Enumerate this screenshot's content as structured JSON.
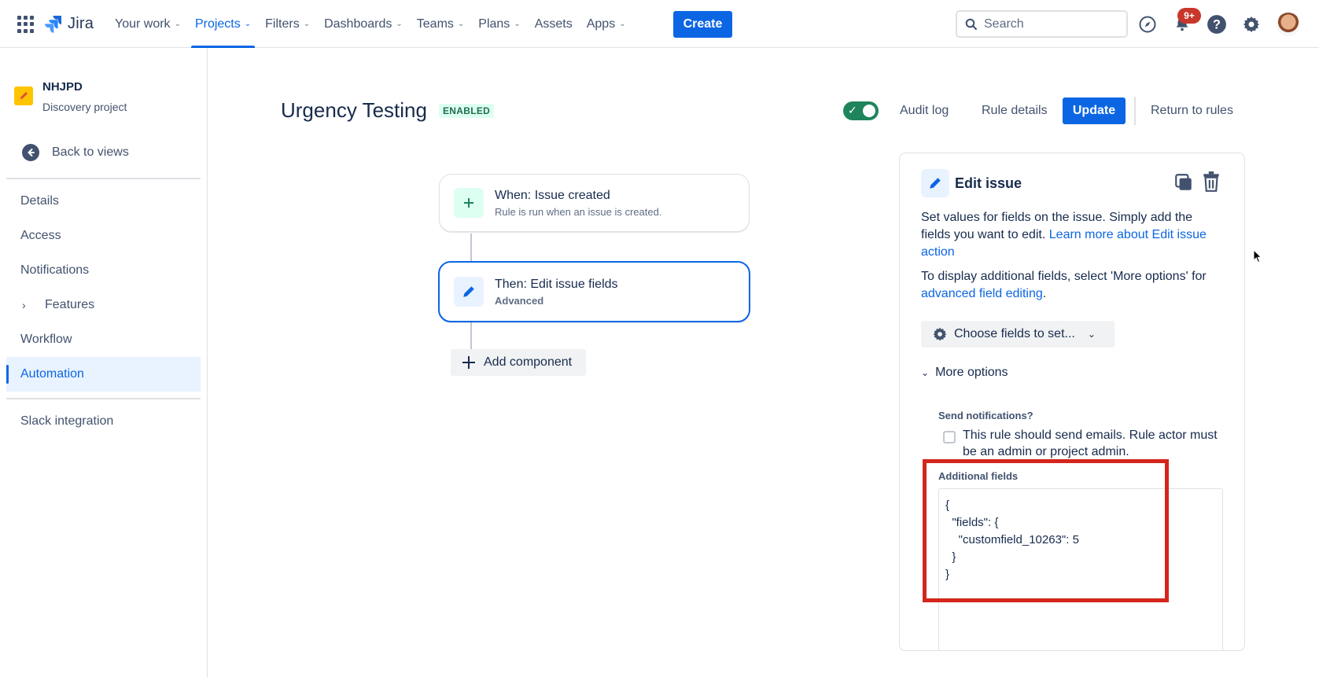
{
  "topnav": {
    "logo_text": "Jira",
    "items": [
      {
        "label": "Your work",
        "has_menu": true
      },
      {
        "label": "Projects",
        "has_menu": true,
        "active": true
      },
      {
        "label": "Filters",
        "has_menu": true
      },
      {
        "label": "Dashboards",
        "has_menu": true
      },
      {
        "label": "Teams",
        "has_menu": true
      },
      {
        "label": "Plans",
        "has_menu": true
      },
      {
        "label": "Assets",
        "has_menu": false
      },
      {
        "label": "Apps",
        "has_menu": true
      }
    ],
    "create_label": "Create",
    "search_placeholder": "Search",
    "notification_count": "9+",
    "icons": [
      "app-switcher-icon",
      "jira-logo-icon",
      "search-icon",
      "compass-icon",
      "notification-bell-icon",
      "help-icon",
      "settings-gear-icon",
      "avatar"
    ]
  },
  "sidebar": {
    "project_name": "NHJPD",
    "project_type": "Discovery project",
    "back_label": "Back to views",
    "items": [
      {
        "label": "Details"
      },
      {
        "label": "Access"
      },
      {
        "label": "Notifications"
      },
      {
        "label": "Features",
        "expandable": true
      },
      {
        "label": "Workflow"
      },
      {
        "label": "Automation",
        "active": true
      }
    ],
    "integrations": [
      {
        "label": "Slack integration"
      }
    ]
  },
  "header": {
    "title": "Urgency Testing",
    "status": "ENABLED",
    "toggle_on": true,
    "audit_log_label": "Audit log",
    "rule_details_label": "Rule details",
    "update_label": "Update",
    "return_label": "Return to rules"
  },
  "rule": {
    "trigger": {
      "title": "When: Issue created",
      "subtitle": "Rule is run when an issue is created."
    },
    "action": {
      "title": "Then: Edit issue fields",
      "subtitle": "Advanced"
    },
    "add_component_label": "Add component"
  },
  "panel": {
    "title": "Edit issue",
    "desc_part1": "Set values for fields on the issue. Simply add the fields you want to edit. ",
    "desc_link": "Learn more about Edit issue action",
    "desc2_part1": "To display additional fields, select 'More options' for ",
    "desc2_link": "advanced field editing",
    "desc2_end": ".",
    "choose_fields_label": "Choose fields to set...",
    "more_options_label": "More options",
    "send_notifications_label": "Send notifications?",
    "send_notifications_checked": false,
    "send_notifications_text": "This rule should send emails. Rule actor must be an admin or project admin.",
    "additional_fields_label": "Additional fields",
    "additional_fields_value": "{\n  \"fields\": {\n    \"customfield_10263\": 5\n  }\n}"
  },
  "colors": {
    "primary": "#0C66E4",
    "enabled_bg": "#DCFFF1",
    "enabled_text": "#216E4E",
    "toggle_on": "#1F845A",
    "highlight": "#D3261D"
  }
}
